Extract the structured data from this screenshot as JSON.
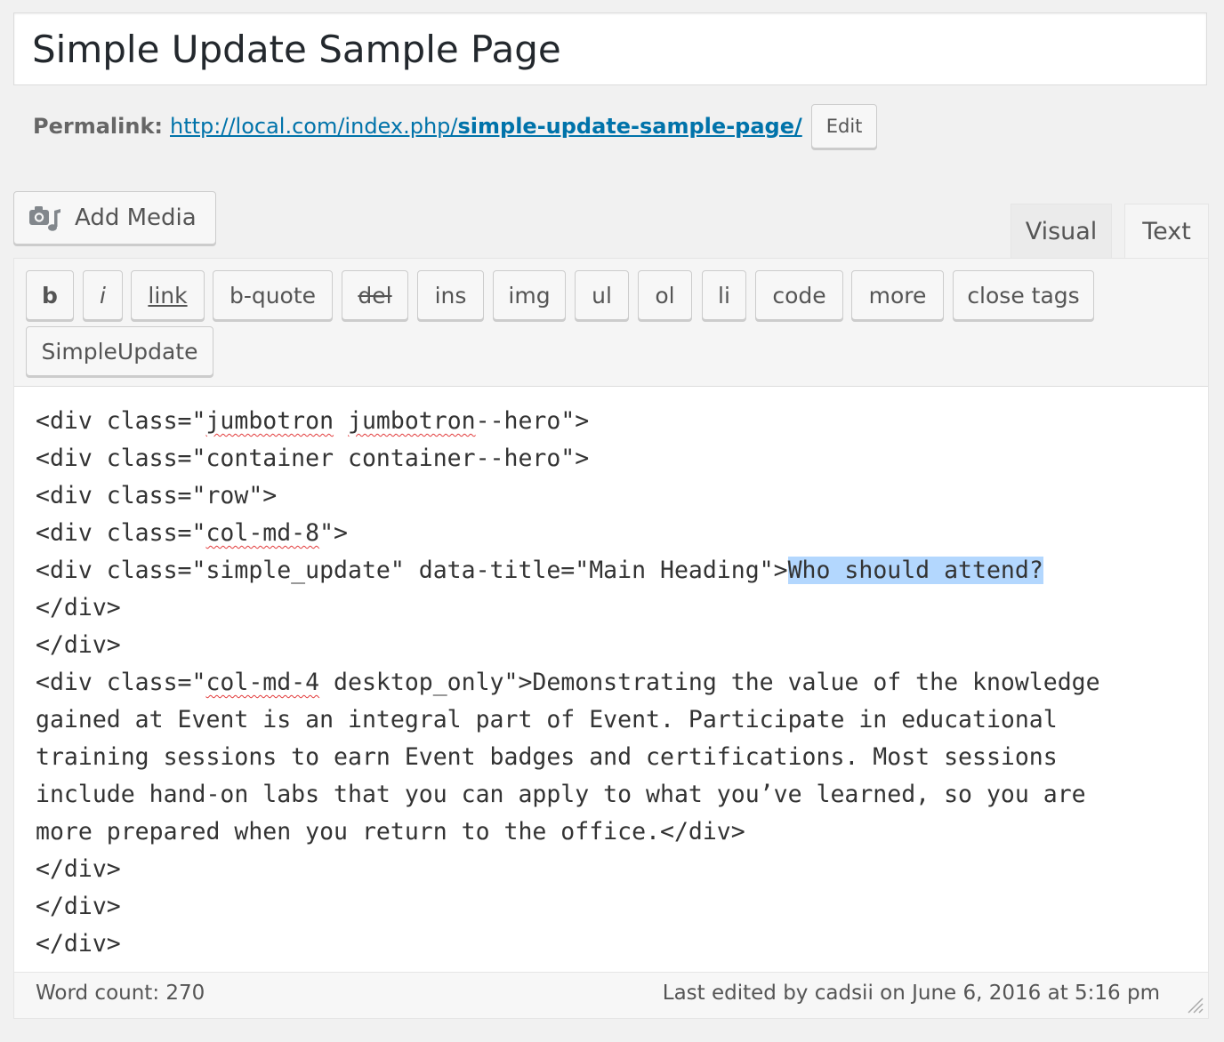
{
  "post": {
    "title": "Simple Update Sample Page"
  },
  "permalink": {
    "label": "Permalink:",
    "url_base": "http://local.com/index.php/",
    "url_slug": "simple-update-sample-page/",
    "edit_label": "Edit"
  },
  "media": {
    "add_media_label": "Add Media",
    "icon": "media-icon"
  },
  "editor_tabs": {
    "visual_label": "Visual",
    "text_label": "Text",
    "active": "Text"
  },
  "quicktags": [
    "b",
    "i",
    "link",
    "b-quote",
    "del",
    "ins",
    "img",
    "ul",
    "ol",
    "li",
    "code",
    "more",
    "close tags",
    "SimpleUpdate"
  ],
  "content": {
    "l1a": "<div class=\"",
    "l1b": "jumbotron",
    "l1c": " ",
    "l1d": "jumbotron",
    "l1e": "--hero\">",
    "l2": "<div class=\"container container--hero\">",
    "l3": "<div class=\"row\">",
    "l4a": "<div class=\"",
    "l4b": "col-md-8",
    "l4c": "\">",
    "l5a": "<div class=\"simple_update\" data-title=\"Main Heading\">",
    "l5b": "Who should attend?",
    "l6": "</div>",
    "l7": "</div>",
    "l8a": "<div class=\"",
    "l8b": "col-md-4",
    "l8c": " desktop_only\">Demonstrating the value of the knowledge",
    "l9": "gained at Event is an integral part of Event. Participate in educational",
    "l10": "training sessions to earn Event badges and certifications. Most sessions",
    "l11": "include hand-on labs that you can apply to what you’ve learned, so you are",
    "l12": "more prepared when you return to the office.</div>",
    "l13": "</div>",
    "l14": "</div>",
    "l15": "</div>"
  },
  "status": {
    "word_count": "Word count: 270",
    "last_edited": "Last edited by cadsii on June 6, 2016 at 5:16 pm"
  },
  "colors": {
    "link": "#0073aa",
    "selection": "#b3d7fe",
    "background": "#f1f1f1"
  }
}
